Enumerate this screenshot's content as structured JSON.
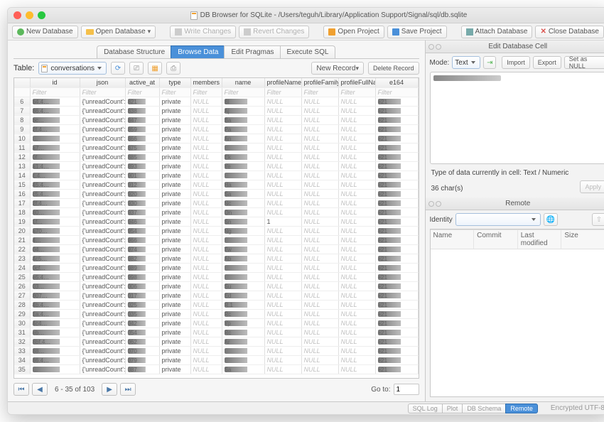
{
  "window": {
    "title": "DB Browser for SQLite - /Users/teguh/Library/Application Support/Signal/sql/db.sqlite"
  },
  "toolbar": {
    "new_db": "New Database",
    "open_db": "Open Database",
    "write": "Write Changes",
    "revert": "Revert Changes",
    "open_proj": "Open Project",
    "save_proj": "Save Project",
    "attach": "Attach Database",
    "close_db": "Close Database"
  },
  "maintabs": {
    "structure": "Database Structure",
    "browse": "Browse Data",
    "pragmas": "Edit Pragmas",
    "sql": "Execute SQL"
  },
  "browse": {
    "table_label": "Table:",
    "table_value": "conversations",
    "new_record": "New Record",
    "delete_record": "Delete Record",
    "columns": [
      "",
      "id",
      "json",
      "active_at",
      "type",
      "members",
      "name",
      "profileName",
      "profileFamilyName",
      "profileFullName",
      "e164"
    ],
    "filter": "Filter",
    "rows": [
      {
        "n": "6",
        "id": "b4.4…",
        "json": "{'unreadCount':0…",
        "active": "821",
        "type": "private",
        "members": "NULL",
        "name": "Bl",
        "pn": "NULL",
        "pfn": "NULL",
        "pfull": "NULL",
        "e164": "+21"
      },
      {
        "n": "7",
        "id": "86.4…",
        "json": "{'unreadCount':0…",
        "active": "838",
        "type": "private",
        "members": "NULL",
        "name": "Aj",
        "pn": "NULL",
        "pfn": "NULL",
        "pfull": "NULL",
        "e164": "+21"
      },
      {
        "n": "8",
        "id": "bc…",
        "json": "{'unreadCount':0…",
        "active": "847",
        "type": "private",
        "members": "NULL",
        "name": "Ba",
        "pn": "NULL",
        "pfn": "NULL",
        "pfull": "NULL",
        "e164": "+21"
      },
      {
        "n": "9",
        "id": "2f.4…",
        "json": "{'unreadCount':0…",
        "active": "859",
        "type": "private",
        "members": "NULL",
        "name": "Pa",
        "pn": "NULL",
        "pfn": "NULL",
        "pfull": "NULL",
        "e164": "+21"
      },
      {
        "n": "10",
        "id": "…",
        "json": "{'unreadCount':0…",
        "active": "866",
        "type": "private",
        "members": "NULL",
        "name": "An",
        "pn": "NULL",
        "pfn": "NULL",
        "pfull": "NULL",
        "e164": "+21"
      },
      {
        "n": "11",
        "id": "a7…",
        "json": "{'unreadCount':0…",
        "active": "875",
        "type": "private",
        "members": "NULL",
        "name": "",
        "pn": "NULL",
        "pfn": "NULL",
        "pfull": "NULL",
        "e164": "+21"
      },
      {
        "n": "12",
        "id": "0f…",
        "json": "{'unreadCount':0…",
        "active": "885",
        "type": "private",
        "members": "NULL",
        "name": "Ek",
        "pn": "NULL",
        "pfn": "NULL",
        "pfull": "NULL",
        "e164": "+21"
      },
      {
        "n": "13",
        "id": "a1.4…",
        "json": "{'unreadCount':0…",
        "active": "893",
        "type": "private",
        "members": "NULL",
        "name": "Ye",
        "pn": "NULL",
        "pfn": "NULL",
        "pfull": "NULL",
        "e164": "+21"
      },
      {
        "n": "14",
        "id": "c.4…",
        "json": "{'unreadCount':0…",
        "active": "901",
        "type": "private",
        "members": "NULL",
        "name": "",
        "pn": "NULL",
        "pfn": "NULL",
        "pfull": "NULL",
        "e164": "+21"
      },
      {
        "n": "15",
        "id": "45.4…",
        "json": "{'unreadCount':0…",
        "active": "912",
        "type": "private",
        "members": "NULL",
        "name": "Ha",
        "pn": "NULL",
        "pfn": "NULL",
        "pfull": "NULL",
        "e164": "+21"
      },
      {
        "n": "16",
        "id": "c5.4…",
        "json": "{'unreadCount':0…",
        "active": "920",
        "type": "private",
        "members": "NULL",
        "name": "Sa",
        "pn": "NULL",
        "pfn": "NULL",
        "pfull": "NULL",
        "e164": "+21"
      },
      {
        "n": "17",
        "id": "2f.4…",
        "json": "{'unreadCount':0…",
        "active": "930",
        "type": "private",
        "members": "NULL",
        "name": "Nc",
        "pn": "NULL",
        "pfn": "NULL",
        "pfull": "NULL",
        "e164": "+21"
      },
      {
        "n": "18",
        "id": "80…",
        "json": "{'unreadCount':0…",
        "active": "937",
        "type": "private",
        "members": "NULL",
        "name": "On",
        "pn": "NULL",
        "pfn": "NULL",
        "pfull": "NULL",
        "e164": "+21"
      },
      {
        "n": "19",
        "id": "1f…",
        "json": "{'unreadCount':0…",
        "active": "946",
        "type": "private",
        "members": "NULL",
        "name": "Sn",
        "pn": "1",
        "pfn": "NULL",
        "pfull": "NULL",
        "e164": "+21"
      },
      {
        "n": "20",
        "id": "a70…",
        "json": "{'unreadCount':0…",
        "active": "954",
        "type": "private",
        "members": "NULL",
        "name": "Ng",
        "pn": "NULL",
        "pfn": "NULL",
        "pfull": "NULL",
        "e164": "+21"
      },
      {
        "n": "21",
        "id": "4…",
        "json": "{'unreadCount':0…",
        "active": "966",
        "type": "private",
        "members": "NULL",
        "name": "",
        "pn": "NULL",
        "pfn": "NULL",
        "pfull": "NULL",
        "e164": "+21"
      },
      {
        "n": "22",
        "id": "04…",
        "json": "{'unreadCount':0…",
        "active": "974",
        "type": "private",
        "members": "NULL",
        "name": "Tw",
        "pn": "NULL",
        "pfn": "NULL",
        "pfull": "NULL",
        "e164": "+21"
      },
      {
        "n": "23",
        "id": "4c5…",
        "json": "{'unreadCount':0…",
        "active": "982",
        "type": "private",
        "members": "NULL",
        "name": "Ab",
        "pn": "NULL",
        "pfn": "NULL",
        "pfull": "NULL",
        "e164": "+21"
      },
      {
        "n": "24",
        "id": "0cf…",
        "json": "{'unreadCount':0…",
        "active": "989",
        "type": "private",
        "members": "NULL",
        "name": "",
        "pn": "NULL",
        "pfn": "NULL",
        "pfull": "NULL",
        "e164": "+21"
      },
      {
        "n": "25",
        "id": "e5.4…",
        "json": "{'unreadCount':0…",
        "active": "998",
        "type": "private",
        "members": "NULL",
        "name": "",
        "pn": "NULL",
        "pfn": "NULL",
        "pfull": "NULL",
        "e164": "+21"
      },
      {
        "n": "26",
        "id": "03…",
        "json": "{'unreadCount':0…",
        "active": "006",
        "type": "private",
        "members": "NULL",
        "name": "Su",
        "pn": "NULL",
        "pfn": "NULL",
        "pfull": "NULL",
        "e164": "+21"
      },
      {
        "n": "27",
        "id": "807…",
        "json": "{'unreadCount':0…",
        "active": "017",
        "type": "private",
        "members": "NULL",
        "name": "Ed",
        "pn": "NULL",
        "pfn": "NULL",
        "pfull": "NULL",
        "e164": "+21"
      },
      {
        "n": "28",
        "id": "4b.4…",
        "json": "{'unreadCount':0…",
        "active": "025",
        "type": "private",
        "members": "NULL",
        "name": "R.1",
        "pn": "NULL",
        "pfn": "NULL",
        "pfull": "NULL",
        "e164": "+21"
      },
      {
        "n": "29",
        "id": "1a.4…",
        "json": "{'unreadCount':0…",
        "active": "035",
        "type": "private",
        "members": "NULL",
        "name": "Rc",
        "pn": "NULL",
        "pfn": "NULL",
        "pfull": "NULL",
        "e164": "+21"
      },
      {
        "n": "30",
        "id": "4c4…",
        "json": "{'unreadCount':0…",
        "active": "042",
        "type": "private",
        "members": "NULL",
        "name": "Yp",
        "pn": "NULL",
        "pfn": "NULL",
        "pfull": "NULL",
        "e164": "+21"
      },
      {
        "n": "31",
        "id": "eb…",
        "json": "{'unreadCount':0…",
        "active": "054",
        "type": "private",
        "members": "NULL",
        "name": "Rc",
        "pn": "NULL",
        "pfn": "NULL",
        "pfull": "NULL",
        "e164": "+21"
      },
      {
        "n": "32",
        "id": "8bf.4…",
        "json": "{'unreadCount':0…",
        "active": "062",
        "type": "private",
        "members": "NULL",
        "name": "Ar",
        "pn": "NULL",
        "pfn": "NULL",
        "pfull": "NULL",
        "e164": "+21"
      },
      {
        "n": "33",
        "id": "88…",
        "json": "{'unreadCount':0…",
        "active": "070",
        "type": "private",
        "members": "NULL",
        "name": "",
        "pn": "NULL",
        "pfn": "NULL",
        "pfull": "NULL",
        "e164": "+21"
      },
      {
        "n": "34",
        "id": "86.4…",
        "json": "{'unreadCount':0…",
        "active": "079",
        "type": "private",
        "members": "NULL",
        "name": "",
        "pn": "NULL",
        "pfn": "NULL",
        "pfull": "NULL",
        "e164": "+21"
      },
      {
        "n": "35",
        "id": "…",
        "json": "{'unreadCount':0…",
        "active": "087",
        "type": "private",
        "members": "NULL",
        "name": "Sa",
        "pn": "NULL",
        "pfn": "NULL",
        "pfull": "NULL",
        "e164": "+21"
      }
    ],
    "pager_text": "6 - 35 of 103",
    "goto_label": "Go to:",
    "goto_value": "1"
  },
  "edit_cell": {
    "title": "Edit Database Cell",
    "mode_label": "Mode:",
    "mode_value": "Text",
    "import": "Import",
    "export": "Export",
    "set_null": "Set as NULL",
    "info1": "Type of data currently in cell: Text / Numeric",
    "info2": "36 char(s)",
    "apply": "Apply"
  },
  "remote": {
    "title": "Remote",
    "identity_label": "Identity",
    "cols": {
      "name": "Name",
      "commit": "Commit",
      "last": "Last modified",
      "size": "Size"
    }
  },
  "statusbar": {
    "sql_log": "SQL Log",
    "plot": "Plot",
    "db_schema": "DB Schema",
    "remote": "Remote",
    "encoding": "Encrypted  UTF-8"
  }
}
